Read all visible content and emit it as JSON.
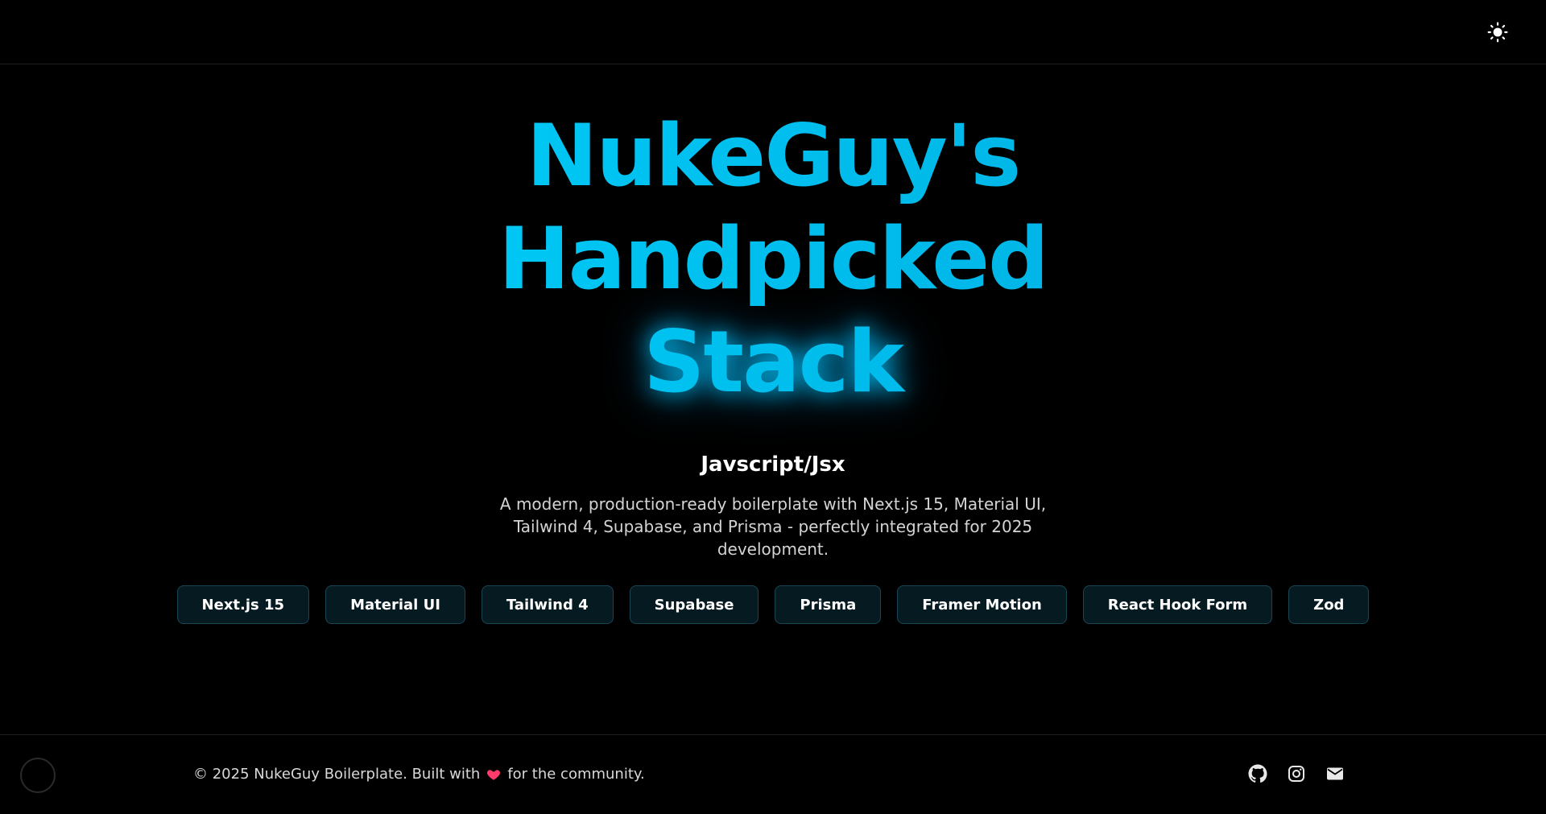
{
  "header": {
    "theme_toggle_icon": "sun-icon"
  },
  "hero": {
    "title_lines": [
      "NukeGuy's",
      "Handpicked",
      "Stack"
    ],
    "subtitle": "Javscript/Jsx",
    "description": "A modern, production-ready boilerplate with Next.js 15, Material UI, Tailwind 4, Supabase, and Prisma - perfectly integrated for 2025 development."
  },
  "tags": [
    {
      "label": "Next.js 15"
    },
    {
      "label": "Material UI"
    },
    {
      "label": "Tailwind 4"
    },
    {
      "label": "Supabase"
    },
    {
      "label": "Prisma"
    },
    {
      "label": "Framer Motion"
    },
    {
      "label": "React Hook Form"
    },
    {
      "label": "Zod"
    }
  ],
  "footer": {
    "copyright_prefix": "© 2025 NukeGuy Boilerplate. Built with",
    "copyright_suffix": "for the community.",
    "heart_icon": "heart-icon",
    "icons": [
      "github-icon",
      "instagram-icon",
      "mail-icon"
    ]
  },
  "colors": {
    "accent": "#00c8f0",
    "accent_dark": "#00a7dc",
    "background": "#000000",
    "tag_bg": "#061a22",
    "tag_border": "#1a4654",
    "heart": "#ff3b6b"
  }
}
